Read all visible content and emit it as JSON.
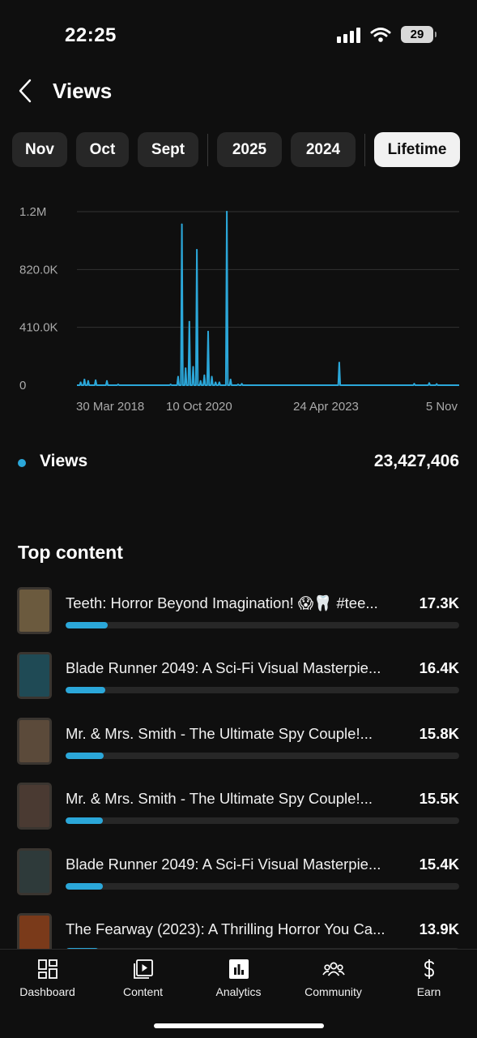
{
  "status_bar": {
    "time": "22:25",
    "battery": "29"
  },
  "header": {
    "title": "Views"
  },
  "periods": [
    {
      "label": "Nov",
      "active": false
    },
    {
      "label": "Oct",
      "active": false
    },
    {
      "label": "Sept",
      "active": false
    },
    {
      "label": "2025",
      "active": false
    },
    {
      "label": "2024",
      "active": false
    },
    {
      "label": "Lifetime",
      "active": true
    }
  ],
  "chart_data": {
    "type": "line",
    "y_ticks": [
      "1.2M",
      "820.0K",
      "410.0K",
      "0"
    ],
    "x_ticks": [
      "30 Mar 2018",
      "10 Oct 2020",
      "24 Apr 2023",
      "5 Nov"
    ],
    "ylim": [
      0,
      1230000
    ],
    "grid": true,
    "color": "#2ba7d9",
    "series": [
      {
        "x": [
          "2017-06",
          "2017-07",
          "2017-08",
          "2017-10",
          "2018-01",
          "2018-04",
          "2019-06",
          "2019-08",
          "2019-09",
          "2019-10",
          "2019-11",
          "2019-12",
          "2020-01",
          "2020-02",
          "2020-03",
          "2020-04",
          "2020-05",
          "2020-06",
          "2020-07",
          "2020-09",
          "2020-10",
          "2020-12",
          "2021-01",
          "2023-03",
          "2024-11",
          "2025-03",
          "2025-05"
        ],
        "values": [
          20000,
          40000,
          30000,
          35000,
          30000,
          5000,
          5000,
          60000,
          1140000,
          120000,
          450000,
          130000,
          960000,
          30000,
          70000,
          380000,
          60000,
          20000,
          20000,
          1230000,
          40000,
          5000,
          10000,
          160000,
          10000,
          15000,
          8000
        ]
      }
    ]
  },
  "summary": {
    "label": "Views",
    "value": "23,427,406"
  },
  "top_content": {
    "title": "Top content",
    "items": [
      {
        "title": "Teeth: Horror Beyond Imagination! 😱🦷 #tee...",
        "value": "17.3K",
        "share": 0.106,
        "thumb_color": "#6b5a3e"
      },
      {
        "title": "Blade Runner 2049: A Sci-Fi Visual Masterpie...",
        "value": "16.4K",
        "share": 0.101,
        "thumb_color": "#1f4a55"
      },
      {
        "title": "Mr. & Mrs. Smith - The Ultimate Spy Couple!...",
        "value": "15.8K",
        "share": 0.097,
        "thumb_color": "#5b4a3a"
      },
      {
        "title": "Mr. & Mrs. Smith - The Ultimate Spy Couple!...",
        "value": "15.5K",
        "share": 0.095,
        "thumb_color": "#4a3a32"
      },
      {
        "title": "Blade Runner 2049: A Sci-Fi Visual Masterpie...",
        "value": "15.4K",
        "share": 0.094,
        "thumb_color": "#2e3a3a"
      },
      {
        "title": "The Fearway (2023): A Thrilling Horror You Ca...",
        "value": "13.9K",
        "share": 0.085,
        "thumb_color": "#7a3a1a"
      }
    ]
  },
  "bottom_nav": {
    "items": [
      {
        "label": "Dashboard",
        "icon": "dashboard-icon"
      },
      {
        "label": "Content",
        "icon": "content-icon"
      },
      {
        "label": "Analytics",
        "icon": "analytics-icon"
      },
      {
        "label": "Community",
        "icon": "community-icon"
      },
      {
        "label": "Earn",
        "icon": "earn-icon"
      }
    ]
  }
}
